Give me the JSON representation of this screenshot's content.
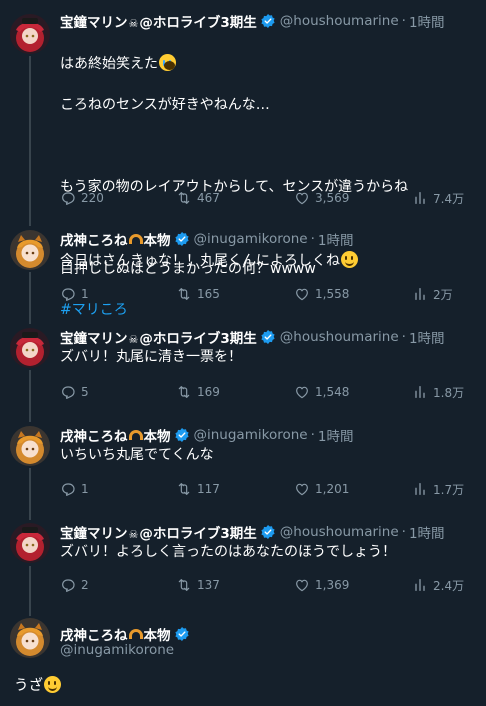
{
  "tweets": [
    {
      "name": "宝鐘マリン",
      "name_suffix": "@ホロライブ3期生",
      "handle": "@houshoumarine",
      "time": "1時間",
      "body_lines": [
        "はあ終始笑えた",
        "ころねのセンスが好きやねんな…",
        "",
        "もう家の物のレイアウトからして、センスが違うからね",
        "",
        "目押ししぬほどうまかったの何？wwww"
      ],
      "hashtag": "#マリころ",
      "replies": "220",
      "retweets": "467",
      "likes": "3,569",
      "views": "7.4万"
    },
    {
      "name": "戌神ころね",
      "name_suffix": "本物",
      "handle": "@inugamikorone",
      "time": "1時間",
      "body": "今日はさんきゅな！！丸尾くんによろしくね",
      "replies": "1",
      "retweets": "165",
      "likes": "1,558",
      "views": "2万"
    },
    {
      "name": "宝鐘マリン",
      "name_suffix": "@ホロライブ3期生",
      "handle": "@houshoumarine",
      "time": "1時間",
      "body": "ズバリ！丸尾に清き一票を！",
      "replies": "5",
      "retweets": "169",
      "likes": "1,548",
      "views": "1.8万"
    },
    {
      "name": "戌神ころね",
      "name_suffix": "本物",
      "handle": "@inugamikorone",
      "time": "1時間",
      "body": "いちいち丸尾でてくんな",
      "replies": "1",
      "retweets": "117",
      "likes": "1,201",
      "views": "1.7万"
    },
    {
      "name": "宝鐘マリン",
      "name_suffix": "@ホロライブ3期生",
      "handle": "@houshoumarine",
      "time": "1時間",
      "body": "ズバリ！よろしく言ったのはあなたのほうでしょう！",
      "replies": "2",
      "retweets": "137",
      "likes": "1,369",
      "views": "2.4万"
    }
  ],
  "final_tweet": {
    "name": "戌神ころね",
    "name_suffix": "本物",
    "handle": "@inugamikorone",
    "body": "うざ"
  },
  "colors": {
    "background": "#15202b",
    "secondary_text": "#8899a6",
    "link": "#1da1f2",
    "verified": "#1d9bf0",
    "marine_accent": "#b3212f",
    "korone_accent": "#e89a2c"
  },
  "icons": {
    "reply": "speech-bubble-icon",
    "retweet": "retweet-arrows-icon",
    "like": "heart-icon",
    "views": "bar-chart-icon",
    "verified": "verified-badge-icon"
  }
}
